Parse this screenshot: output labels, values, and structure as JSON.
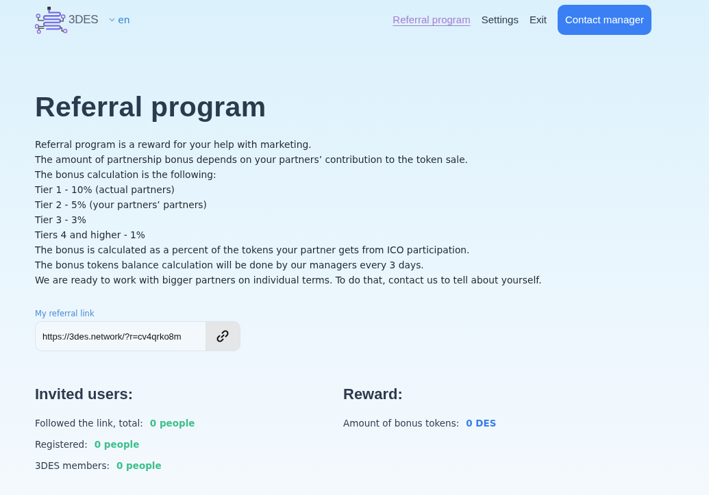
{
  "header": {
    "logo_text": "3DES",
    "language": "en",
    "nav_links": [
      {
        "label": "Referral program",
        "selected": true
      },
      {
        "label": "Settings",
        "selected": false
      },
      {
        "label": "Exit",
        "selected": false
      }
    ],
    "contact_button": "Contact manager"
  },
  "page_title": "Referral program",
  "description_lines": [
    "Referral program is a reward for your help with marketing.",
    "The amount of partnership bonus depends on your partners’ contribution to the token sale.",
    "The bonus calculation is the following:",
    "Tier 1 - 10% (actual partners)",
    "Tier 2 - 5% (your partners’ partners)",
    "Tier 3 - 3%",
    "Tiers 4 and higher - 1%",
    "The bonus is calculated as a percent of the tokens your partner gets from ICO participation.",
    "The bonus tokens balance calculation will be done by our managers every 3 days.",
    "We are ready to work with bigger partners on individual terms. To do that, contact us to tell about yourself."
  ],
  "referral_link": {
    "label": "My referral link",
    "value": "https://3des.network/?r=cv4qrko8m"
  },
  "invited_users": {
    "title": "Invited users:",
    "stats": [
      {
        "label": "Followed the link, total:",
        "value": "0 people"
      },
      {
        "label": "Registered:",
        "value": "0 people"
      },
      {
        "label": "3DES members:",
        "value": "0 people"
      }
    ]
  },
  "reward": {
    "title": "Reward:",
    "stats": [
      {
        "label": "Amount of bonus tokens:",
        "value": "0 DES"
      }
    ]
  }
}
